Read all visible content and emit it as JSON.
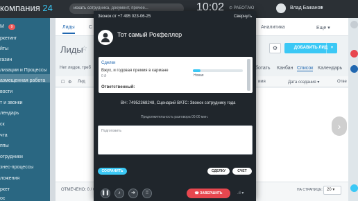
{
  "header": {
    "brand": "компания",
    "brand_number": "24",
    "search_placeholder": "искать сотрудника, документ, прочее...",
    "clock": "10:02",
    "work_status": "РАБОТАЮ",
    "user_name": "Влад Бажанов"
  },
  "sidebar": {
    "badge": "9",
    "items": [
      {
        "label": "M"
      },
      {
        "label": "ркетинг"
      },
      {
        "label": "йты"
      },
      {
        "label": "газин"
      },
      {
        "label": "лизации и Процессы"
      },
      {
        "label": "азмещенная работа"
      },
      {
        "label": "вости"
      },
      {
        "label": "т и звонки"
      },
      {
        "label": "лендарь"
      },
      {
        "label": "ск"
      },
      {
        "label": "чта"
      },
      {
        "label": "ппы"
      },
      {
        "label": "отрудники"
      },
      {
        "label": "знес-процессы"
      },
      {
        "label": "ложения"
      },
      {
        "label": "ркет"
      },
      {
        "label": "ос"
      }
    ]
  },
  "crm": {
    "tabs": [
      "Лиды",
      "С",
      "Аналитика",
      "Еще"
    ],
    "page_title": "Лиды",
    "add_lead": "ДОБАВИТЬ ЛИД",
    "filter_text": "Нет лидов, треб",
    "views": [
      "ботать",
      "Канбан",
      "Список",
      "Календарь"
    ],
    "columns": [
      "Лид",
      "имя",
      "Дата создания",
      "Отве"
    ],
    "selected": "ОТМЕЧЕНО: 0 / 0",
    "per_page_label": "НА СТРАНИЦЕ:",
    "per_page_value": "20"
  },
  "call": {
    "title": "Звонок от +7 495 023-06-25",
    "collapse": "Свернуть",
    "caller_name": "Тот самый Рокфеллер",
    "deals_label": "Сделки",
    "deal_name": "Вжух, и годовая премия в кармане",
    "deal_amount": "0 ₽",
    "deal_stage": "Новая",
    "deal_progress": 0.15,
    "responsible_label": "Ответственный:",
    "vn_info": "ВН: 74952368248, Сценарий ВАТС: Звонок сотруднику года",
    "duration": "Продолжительность разговора 00:00 мин.",
    "comment_placeholder": "Подготовить",
    "save": "СОХРАНИТЬ",
    "deal_button": "СДЕЛКУ",
    "invoice_button": "СЧЕТ",
    "hangup": "ЗАВЕРШИТЬ"
  },
  "colors": {
    "accent": "#3bc8f5",
    "hangup": "#e8474f",
    "dialog_bg": "#20262c",
    "link": "#2067b0"
  }
}
